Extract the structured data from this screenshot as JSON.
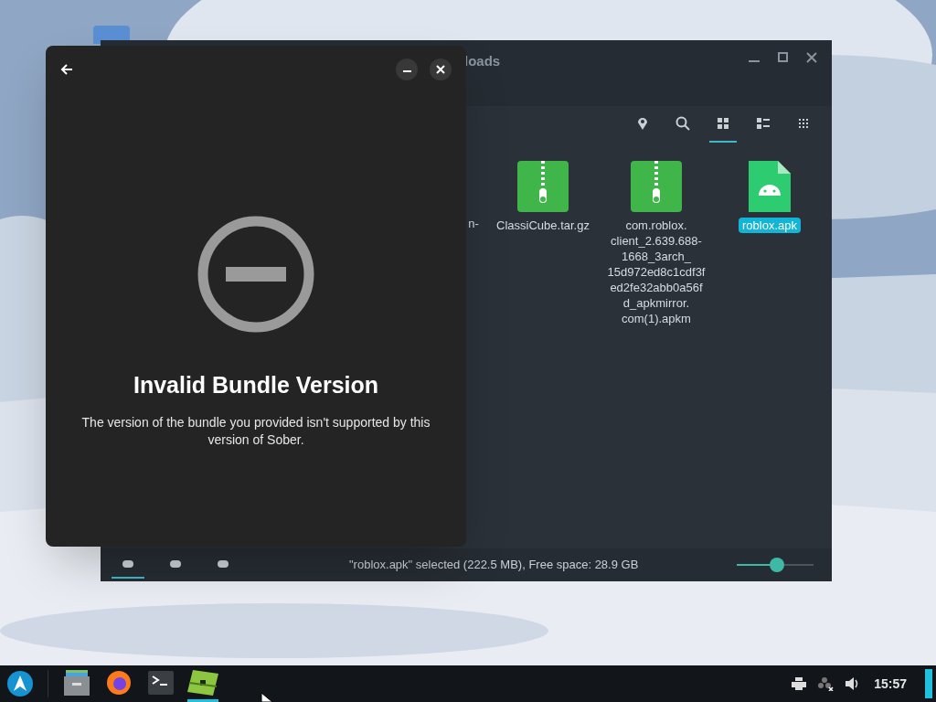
{
  "file_manager": {
    "title": "loads",
    "toolbar": [
      {
        "kind": "location",
        "selected": false
      },
      {
        "kind": "search",
        "selected": false
      },
      {
        "kind": "icons",
        "selected": true
      },
      {
        "kind": "details",
        "selected": false
      },
      {
        "kind": "compact",
        "selected": false
      }
    ],
    "files": [
      {
        "kind": "partial",
        "name": "n-",
        "selected": false
      },
      {
        "kind": "archive",
        "name": "ClassiCube.tar.gz",
        "selected": false
      },
      {
        "kind": "archive",
        "name": "com.roblox.\nclient_2.639.688-\n1668_3arch_\n15d972ed8c1cdf3f\ned2fe32abb0a56f\nd_apkmirror.\ncom(1).apkm",
        "selected": false
      },
      {
        "kind": "apk",
        "name": "roblox.apk",
        "selected": true
      }
    ],
    "status_text": "\"roblox.apk\" selected (222.5 MB), Free space: 28.9 GB",
    "zoom": {
      "level": 0.52
    },
    "view_tabs": [
      {
        "selected": true
      },
      {
        "selected": false
      },
      {
        "selected": false
      }
    ]
  },
  "dialog": {
    "title": "Invalid Bundle Version",
    "message": "The version of the bundle you provided isn't supported by this version of Sober."
  },
  "taskbar": {
    "apps": [
      {
        "kind": "files",
        "active": false
      },
      {
        "kind": "browser",
        "active": false
      },
      {
        "kind": "terminal",
        "active": false
      },
      {
        "kind": "game",
        "active": true
      }
    ],
    "clock": "15:57"
  }
}
